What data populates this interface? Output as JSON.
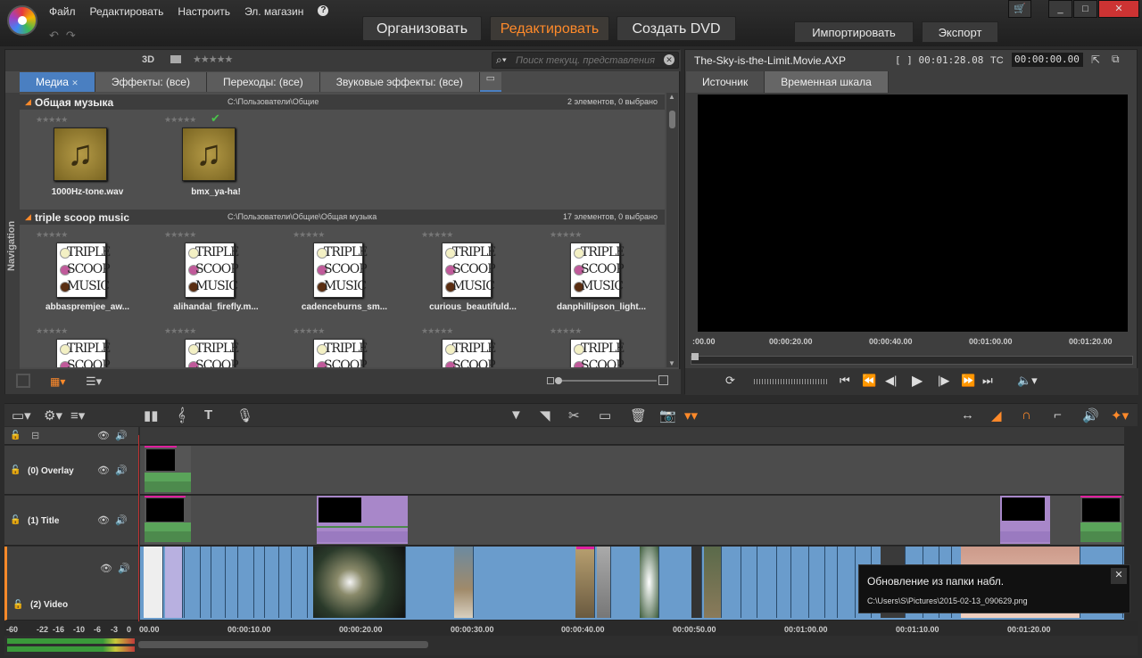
{
  "menu": [
    "Файл",
    "Редактировать",
    "Настроить",
    "Эл. магазин"
  ],
  "modes": {
    "organize": "Организовать",
    "edit": "Редактировать",
    "dvd": "Создать DVD"
  },
  "actions": {
    "import": "Импортировать",
    "export": "Экспорт"
  },
  "library": {
    "label_3d": "3D",
    "stars": "★★★★★",
    "search_placeholder": "Поиск текущ. представления",
    "tabs": [
      "Медиа",
      "Эффекты: (все)",
      "Переходы: (все)",
      "Звуковые эффекты: (все)"
    ],
    "nav_label": "Navigation",
    "groups": [
      {
        "name": "Общая музыка",
        "path": "C:\\Пользователи\\Общие",
        "count": "2 элементов, 0 выбрано",
        "items": [
          "1000Hz-tone.wav",
          "bmx_ya-ha!"
        ]
      },
      {
        "name": "triple scoop music",
        "path": "C:\\Пользователи\\Общие\\Общая музыка",
        "count": "17 элементов, 0 выбрано",
        "items": [
          "abbaspremjee_aw...",
          "alihandal_firefly.m...",
          "cadenceburns_sm...",
          "curious_beautifuld...",
          "danphillipson_light..."
        ]
      }
    ],
    "thumb_words": [
      "TRIPLE",
      "SCOOP",
      "MUSIC"
    ]
  },
  "player": {
    "title": "The-Sky-is-the-Limit.Movie.AXP",
    "duration": "[ ] 00:01:28.08",
    "tc_label": "TC",
    "tc_value": "00:00:00.00",
    "tabs": [
      "Источник",
      "Временная шкала"
    ],
    "ruler": [
      ":00.00",
      "00:00:20.00",
      "00:00:40.00",
      "00:01:00.00",
      "00:01:20.00"
    ]
  },
  "timeline": {
    "tracks": [
      "(0) Overlay",
      "(1) Title",
      "(2) Video"
    ],
    "ruler": [
      "00.00",
      "00:00:10.00",
      "00:00:20.00",
      "00:00:30.00",
      "00:00:40.00",
      "00:00:50.00",
      "00:01:00.00",
      "00:01:10.00",
      "00:01:20.00"
    ],
    "meter": [
      "-60",
      "-22",
      "-16",
      "-10",
      "-6",
      "-3",
      "0"
    ]
  },
  "notification": {
    "title": "Обновление из папки набл.",
    "path": "C:\\Users\\S\\Pictures\\2015-02-13_090629.png"
  },
  "colors": {
    "accent": "#ff8a2a",
    "tab_blue": "#4a7fc1",
    "clip_blue": "#6a9ccc",
    "title_purple": "#a887c9"
  }
}
